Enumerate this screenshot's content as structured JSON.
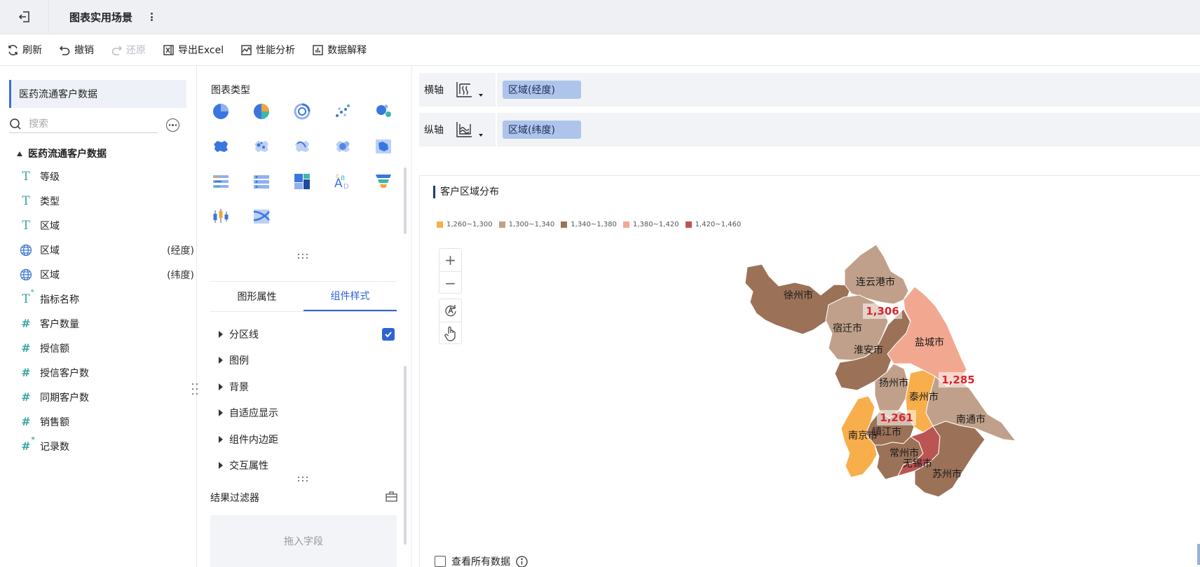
{
  "header": {
    "title": "图表实用场景"
  },
  "toolbar": {
    "refresh": "刷新",
    "undo": "撤销",
    "redo": "还原",
    "export_excel": "导出Excel",
    "perf": "性能分析",
    "explain": "数据解释"
  },
  "left": {
    "dataset": "医药流通客户数据",
    "search_placeholder": "搜索",
    "tree_root": "医药流通客户数据",
    "fields": [
      {
        "icon": "text-icon",
        "label": "等级",
        "suffix": ""
      },
      {
        "icon": "text-icon",
        "label": "类型",
        "suffix": ""
      },
      {
        "icon": "text-icon",
        "label": "区域",
        "suffix": ""
      },
      {
        "icon": "globe-icon",
        "label": "区域",
        "suffix": "(经度)"
      },
      {
        "icon": "globe-icon",
        "label": "区域",
        "suffix": "(纬度)"
      },
      {
        "icon": "text-calc-icon",
        "label": "指标名称",
        "suffix": ""
      },
      {
        "icon": "number-icon",
        "label": "客户数量",
        "suffix": ""
      },
      {
        "icon": "number-icon",
        "label": "授信额",
        "suffix": ""
      },
      {
        "icon": "number-icon",
        "label": "授信客户数",
        "suffix": ""
      },
      {
        "icon": "number-icon",
        "label": "同期客户数",
        "suffix": ""
      },
      {
        "icon": "number-icon",
        "label": "销售额",
        "suffix": ""
      },
      {
        "icon": "number-calc-icon",
        "label": "记录数",
        "suffix": ""
      }
    ]
  },
  "middle": {
    "chart_types_label": "图表类型",
    "tabs": [
      "图形属性",
      "组件样式"
    ],
    "active_tab": 1,
    "props": [
      "分区线",
      "图例",
      "背景",
      "自适应显示",
      "组件内边距",
      "交互属性"
    ],
    "filter_title": "结果过滤器",
    "dropzone": "拖入字段"
  },
  "axes": {
    "x_label": "横轴",
    "x_field": "区域(经度)",
    "y_label": "纵轴",
    "y_field": "区域(纬度)"
  },
  "chart": {
    "title": "客户区域分布",
    "legend": [
      {
        "label": "1,260~1,300",
        "color": "#f7ae4b"
      },
      {
        "label": "1,300~1,340",
        "color": "#c0a08a"
      },
      {
        "label": "1,340~1,380",
        "color": "#9b7158"
      },
      {
        "label": "1,380~1,420",
        "color": "#f2a890"
      },
      {
        "label": "1,420~1,460",
        "color": "#bb5554"
      }
    ],
    "cities": [
      "徐州市",
      "连云港市",
      "宿迁市",
      "淮安市",
      "盐城市",
      "扬州市",
      "泰州市",
      "南通市",
      "南京市",
      "镇江市",
      "常州市",
      "无锡市",
      "苏州市"
    ],
    "value_labels": [
      "1,306",
      "1,285",
      "1,261"
    ],
    "view_all": "查看所有数据"
  },
  "chart_data": {
    "type": "map",
    "title": "客户区域分布",
    "legend_bins": [
      "1,260~1,300",
      "1,300~1,340",
      "1,340~1,380",
      "1,380~1,420",
      "1,420~1,460"
    ],
    "regions": [
      {
        "name": "徐州市",
        "bin": "1,340~1,380"
      },
      {
        "name": "连云港市",
        "bin": "1,300~1,340"
      },
      {
        "name": "宿迁市",
        "bin": "1,300~1,340"
      },
      {
        "name": "淮安市",
        "bin": "1,340~1,380",
        "value": 1306
      },
      {
        "name": "盐城市",
        "bin": "1,380~1,420"
      },
      {
        "name": "扬州市",
        "bin": "1,300~1,340"
      },
      {
        "name": "泰州市",
        "bin": "1,260~1,300",
        "value": 1285
      },
      {
        "name": "南通市",
        "bin": "1,300~1,340"
      },
      {
        "name": "南京市",
        "bin": "1,260~1,300"
      },
      {
        "name": "镇江市",
        "bin": "1,340~1,380",
        "value": 1261
      },
      {
        "name": "常州市",
        "bin": "1,340~1,380"
      },
      {
        "name": "无锡市",
        "bin": "1,420~1,460"
      },
      {
        "name": "苏州市",
        "bin": "1,340~1,380"
      }
    ]
  }
}
